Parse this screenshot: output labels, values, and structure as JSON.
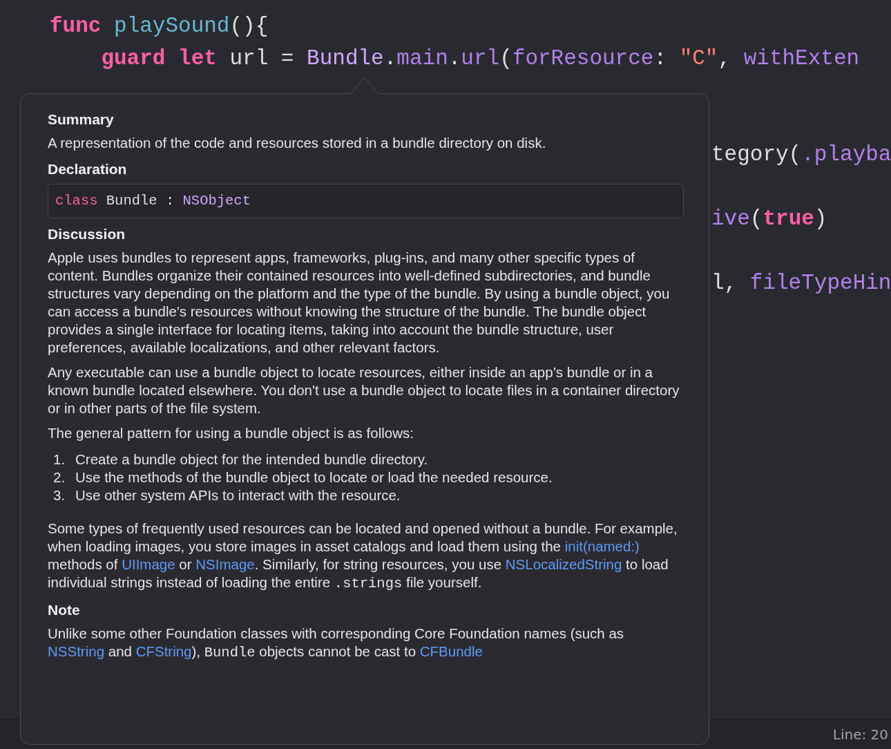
{
  "editor": {
    "lines": [
      {
        "kind": "full",
        "segments": [
          [
            {
              "text": "func",
              "kind": "keyword"
            },
            {
              "text": " playSound",
              "kind": "function"
            },
            {
              "text": "(){",
              "kind": "plain"
            }
          ]
        ]
      },
      {
        "kind": "full",
        "segments": [
          [
            {
              "text": "    guard",
              "kind": "keyword"
            },
            {
              "text": " let",
              "kind": "keyword"
            },
            {
              "text": " url = ",
              "kind": "plain"
            },
            {
              "text": "Bundle",
              "kind": "type"
            },
            {
              "text": ".",
              "kind": "plain"
            },
            {
              "text": "main",
              "kind": "method"
            },
            {
              "text": ".",
              "kind": "plain"
            },
            {
              "text": "url",
              "kind": "method"
            },
            {
              "text": "(",
              "kind": "plain"
            },
            {
              "text": "forResource",
              "kind": "method"
            },
            {
              "text": ": ",
              "kind": "plain"
            },
            {
              "text": "\"C\"",
              "kind": "string"
            },
            {
              "text": ", ",
              "kind": "plain"
            },
            {
              "text": "withExten",
              "kind": "method"
            }
          ]
        ]
      },
      {
        "kind": "blank"
      },
      {
        "kind": "blank"
      },
      {
        "kind": "clipped",
        "segments": [
          [
            {
              "text": "tegory(",
              "kind": "plain"
            },
            {
              "text": ".playba",
              "kind": "method"
            }
          ]
        ]
      },
      {
        "kind": "blank"
      },
      {
        "kind": "clipped",
        "segments": [
          [
            {
              "text": "ive",
              "kind": "method"
            },
            {
              "text": "(",
              "kind": "plain"
            },
            {
              "text": "true",
              "kind": "keyword"
            },
            {
              "text": ")",
              "kind": "plain"
            }
          ]
        ]
      },
      {
        "kind": "blank"
      },
      {
        "kind": "clipped",
        "segments": [
          [
            {
              "text": "l, ",
              "kind": "plain"
            },
            {
              "text": "fileTypeHin",
              "kind": "method"
            }
          ]
        ]
      }
    ]
  },
  "popover": {
    "sections": [
      {
        "heading": "Summary",
        "blocks": [
          {
            "kind": "paragraph",
            "parts": [
              {
                "kind": "text",
                "text": "A representation of the code and resources stored in a bundle directory on disk."
              }
            ]
          }
        ]
      },
      {
        "heading": "Declaration",
        "blocks": [
          {
            "kind": "code",
            "tokens": [
              {
                "text": "class",
                "kind": "keyword"
              },
              {
                "text": " Bundle : ",
                "kind": "plain"
              },
              {
                "text": "NSObject",
                "kind": "type"
              }
            ]
          }
        ]
      },
      {
        "heading": "Discussion",
        "blocks": [
          {
            "kind": "paragraph",
            "parts": [
              {
                "kind": "text",
                "text": "Apple uses bundles to represent apps, frameworks, plug-ins, and many other specific types of content. Bundles organize their contained resources into well-defined subdirectories, and bundle structures vary depending on the platform and the type of the bundle. By using a bundle object, you can access a bundle's resources without knowing the structure of the bundle. The bundle object provides a single interface for locating items, taking into account the bundle structure, user preferences, available localizations, and other relevant factors."
              }
            ]
          },
          {
            "kind": "paragraph",
            "parts": [
              {
                "kind": "text",
                "text": "Any executable can use a bundle object to locate resources, either inside an app’s bundle or in a known bundle located elsewhere. You don't use a bundle object to locate files in a container directory or in other parts of the file system."
              }
            ]
          },
          {
            "kind": "paragraph",
            "parts": [
              {
                "kind": "text",
                "text": "The general pattern for using a bundle object is as follows:"
              }
            ]
          },
          {
            "kind": "list",
            "items": [
              {
                "number": "1.",
                "text": "Create a bundle object for the intended bundle directory."
              },
              {
                "number": "2.",
                "text": "Use the methods of the bundle object to locate or load the needed resource."
              },
              {
                "number": "3.",
                "text": "Use other system APIs to interact with the resource."
              }
            ]
          },
          {
            "kind": "paragraph",
            "parts": [
              {
                "kind": "text",
                "text": "Some types of frequently used resources can be located and opened without a bundle. For example, when loading images, you store images in asset catalogs and load them using the "
              },
              {
                "kind": "link",
                "text": "init(named:)"
              },
              {
                "kind": "text",
                "text": " methods of "
              },
              {
                "kind": "link",
                "text": "UIImage"
              },
              {
                "kind": "text",
                "text": " or "
              },
              {
                "kind": "link",
                "text": "NSImage"
              },
              {
                "kind": "text",
                "text": ". Similarly, for string resources, you use "
              },
              {
                "kind": "link",
                "text": "NSLocalizedString"
              },
              {
                "kind": "text",
                "text": " to load individual strings instead of loading the entire "
              },
              {
                "kind": "code",
                "text": ".strings"
              },
              {
                "kind": "text",
                "text": " file yourself."
              }
            ]
          }
        ]
      },
      {
        "heading": "Note",
        "blocks": [
          {
            "kind": "paragraph",
            "parts": [
              {
                "kind": "text",
                "text": "Unlike some other Foundation classes with corresponding Core Foundation names (such as "
              },
              {
                "kind": "link",
                "text": "NSString"
              },
              {
                "kind": "text",
                "text": " and "
              },
              {
                "kind": "link",
                "text": "CFString"
              },
              {
                "kind": "text",
                "text": "), "
              },
              {
                "kind": "code",
                "text": "Bundle"
              },
              {
                "kind": "text",
                "text": " objects cannot be cast to "
              },
              {
                "kind": "link",
                "text": "CFBundle"
              }
            ]
          }
        ]
      }
    ]
  },
  "status_bar": {
    "position": "Line: 20"
  }
}
